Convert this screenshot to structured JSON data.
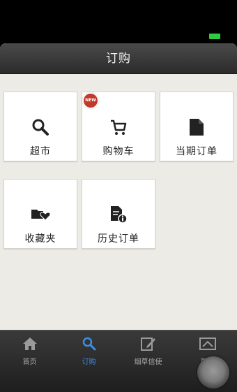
{
  "header": {
    "title": "订购"
  },
  "tiles": [
    {
      "label": "超市",
      "icon": "search-icon"
    },
    {
      "label": "购物车",
      "icon": "cart-icon",
      "badge": "NEW"
    },
    {
      "label": "当期订单",
      "icon": "document-icon"
    },
    {
      "label": "收藏夹",
      "icon": "favorites-folder-icon"
    },
    {
      "label": "历史订单",
      "icon": "history-order-icon"
    }
  ],
  "tabs": [
    {
      "label": "首页",
      "icon": "home-icon",
      "active": false
    },
    {
      "label": "订购",
      "icon": "search-icon",
      "active": true
    },
    {
      "label": "烟草信使",
      "icon": "edit-icon",
      "active": false
    },
    {
      "label": "更多",
      "icon": "more-icon",
      "active": false
    }
  ],
  "colors": {
    "accent": "#3b8fe6",
    "badge": "#c0392b",
    "battery": "#2ecc40"
  }
}
